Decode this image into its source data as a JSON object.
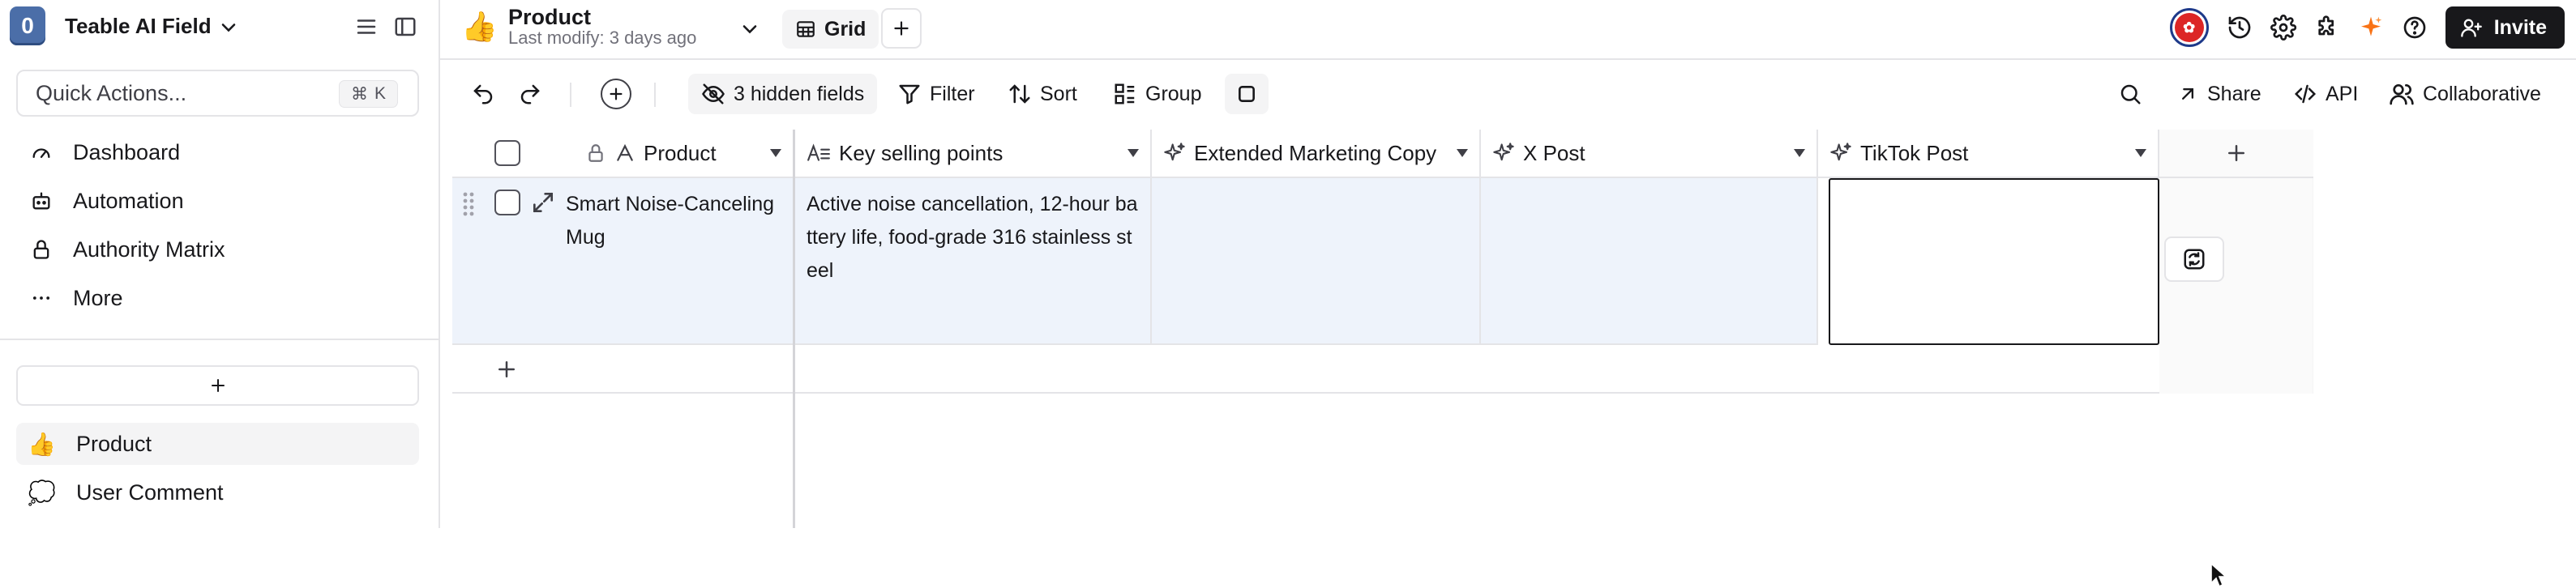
{
  "sidebar": {
    "logo_letter": "0",
    "base_name": "Teable AI Field",
    "quick_actions": {
      "label": "Quick Actions...",
      "shortcut_symbol": "⌘",
      "shortcut_key": "K"
    },
    "nav": [
      {
        "label": "Dashboard",
        "icon": "gauge-icon"
      },
      {
        "label": "Automation",
        "icon": "robot-icon"
      },
      {
        "label": "Authority Matrix",
        "icon": "lock-icon"
      },
      {
        "label": "More",
        "icon": "more-dots-icon"
      }
    ],
    "tables": [
      {
        "emoji": "👍",
        "label": "Product",
        "active": true
      },
      {
        "emoji": "💭",
        "label": "User Comment",
        "active": false
      }
    ]
  },
  "topbar": {
    "table_emoji": "👍",
    "table_name": "Product",
    "last_modify": "Last modify: 3 days ago",
    "view_label": "Grid",
    "invite_label": "Invite"
  },
  "toolbar": {
    "hidden_fields": "3 hidden fields",
    "filter": "Filter",
    "sort": "Sort",
    "group": "Group",
    "share": "Share",
    "api": "API",
    "collaborative": "Collaborative"
  },
  "grid": {
    "columns": [
      {
        "name": "Product",
        "icon": "text-type-icon",
        "locked": true
      },
      {
        "name": "Key selling points",
        "icon": "long-text-icon"
      },
      {
        "name": "Extended Marketing Copy",
        "icon": "ai-sparkle-icon"
      },
      {
        "name": "X Post",
        "icon": "ai-sparkle-icon"
      },
      {
        "name": "TikTok Post",
        "icon": "ai-sparkle-icon"
      }
    ],
    "rows": [
      {
        "product": "Smart Noise-Canceling Mug",
        "key_selling_points": "Active noise cancellation, 12-hour battery life, food-grade 316 stainless  steel",
        "extended_marketing_copy": "",
        "x_post": "",
        "tiktok_post": ""
      }
    ]
  },
  "colors": {
    "accent": "#18181b",
    "row_bg": "#eef3fb",
    "border": "#e4e4e7",
    "spark": "#f97316"
  }
}
